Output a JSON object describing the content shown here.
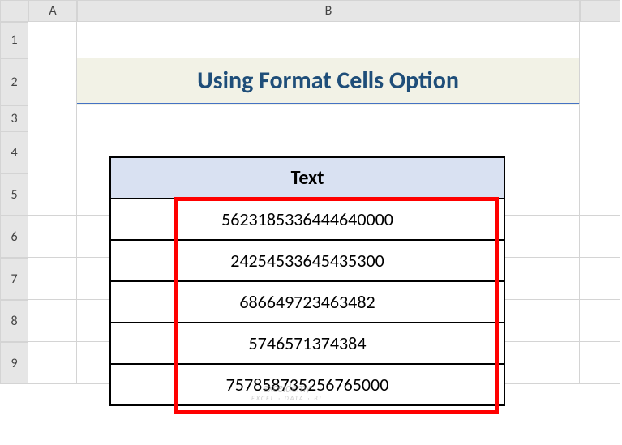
{
  "columns": {
    "A": "A",
    "B": "B"
  },
  "rows": [
    "1",
    "2",
    "3",
    "4",
    "5",
    "6",
    "7",
    "8",
    "9"
  ],
  "title": "Using Format Cells Option",
  "table_header": "Text",
  "table_data": [
    "5623185336444640000",
    "24254533645435300",
    "686649723463482",
    "5746571374384",
    "757858735256765000"
  ],
  "watermark": {
    "main": "exceldemy",
    "sub": "EXCEL · DATA · BI"
  }
}
